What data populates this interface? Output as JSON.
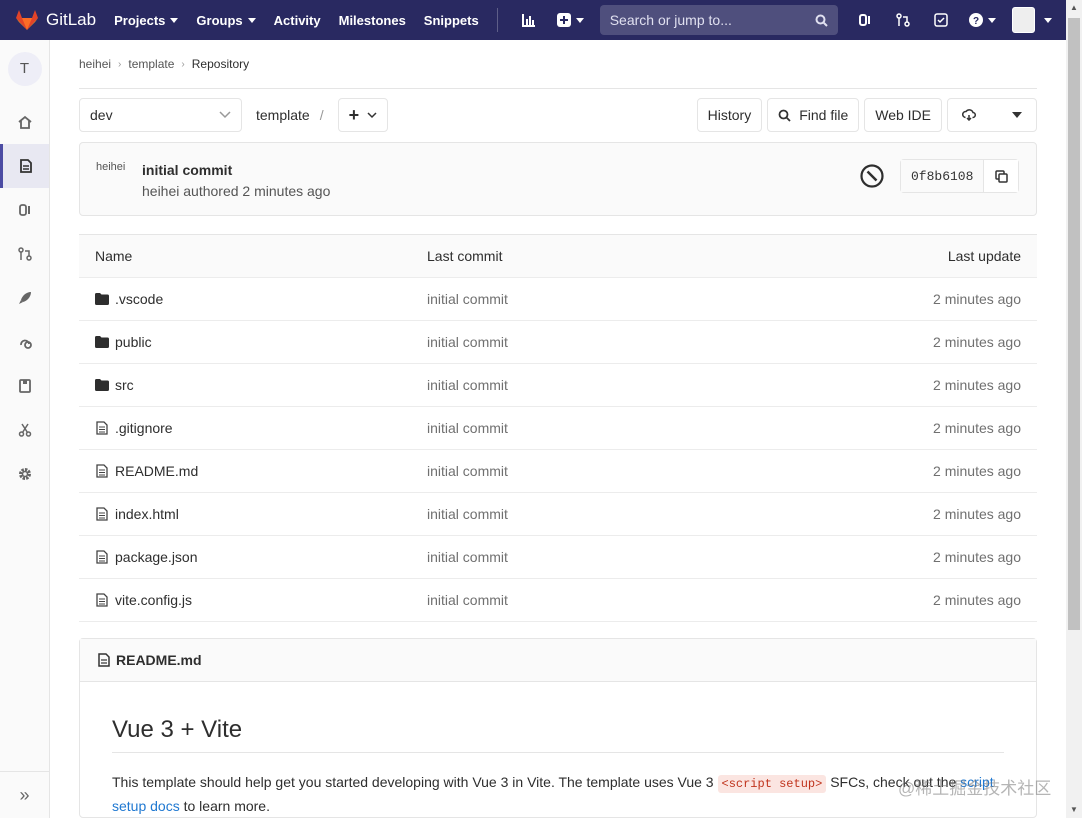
{
  "nav": {
    "brand": "GitLab",
    "projects": "Projects",
    "groups": "Groups",
    "activity": "Activity",
    "milestones": "Milestones",
    "snippets": "Snippets",
    "search_placeholder": "Search or jump to..."
  },
  "sidebar": {
    "project_letter": "T"
  },
  "breadcrumb": {
    "group": "heihei",
    "project": "template",
    "current": "Repository"
  },
  "toolbar": {
    "branch": "dev",
    "path": "template",
    "path_sep": "/",
    "add": "+",
    "history": "History",
    "find_file": "Find file",
    "web_ide": "Web IDE"
  },
  "commit": {
    "avatar_alt": "heihei",
    "title": "initial commit",
    "author": "heihei",
    "meta_rest": " authored 2 minutes ago",
    "sha": "0f8b6108"
  },
  "tree": {
    "headers": {
      "name": "Name",
      "last_commit": "Last commit",
      "last_update": "Last update"
    },
    "rows": [
      {
        "type": "folder",
        "name": ".vscode",
        "commit": "initial commit",
        "updated": "2 minutes ago"
      },
      {
        "type": "folder",
        "name": "public",
        "commit": "initial commit",
        "updated": "2 minutes ago"
      },
      {
        "type": "folder",
        "name": "src",
        "commit": "initial commit",
        "updated": "2 minutes ago"
      },
      {
        "type": "file",
        "name": ".gitignore",
        "commit": "initial commit",
        "updated": "2 minutes ago"
      },
      {
        "type": "file",
        "name": "README.md",
        "commit": "initial commit",
        "updated": "2 minutes ago"
      },
      {
        "type": "file",
        "name": "index.html",
        "commit": "initial commit",
        "updated": "2 minutes ago"
      },
      {
        "type": "file",
        "name": "package.json",
        "commit": "initial commit",
        "updated": "2 minutes ago"
      },
      {
        "type": "file",
        "name": "vite.config.js",
        "commit": "initial commit",
        "updated": "2 minutes ago"
      }
    ]
  },
  "readme": {
    "filename": "README.md",
    "heading": "Vue 3 + Vite",
    "p_before": "This template should help get you started developing with Vue 3 in Vite. The template uses Vue 3 ",
    "code": "<script setup>",
    "p_middle": " SFCs, check out the ",
    "link": "script setup docs",
    "p_after": " to learn more."
  },
  "watermark": "@稀土掘金技术社区",
  "colors": {
    "navbar": "#292961",
    "accent": "#4b4ba3",
    "link": "#1f78d1"
  }
}
